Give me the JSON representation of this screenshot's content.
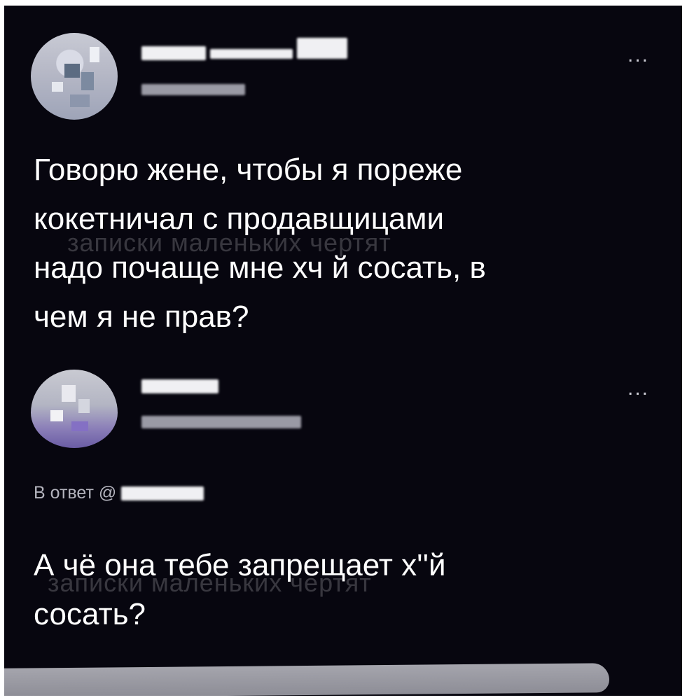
{
  "post": {
    "text": "Говорю жене, чтобы я пореже\nкокетничал с продавщицами\nнадо почаще мне хч й сосать, в\nчем я не прав?",
    "more_label": "..."
  },
  "reply": {
    "reply_prefix": "В ответ @",
    "text": "А чё она тебе запрещает х''й\nсосать?",
    "more_label": "..."
  },
  "watermark": {
    "text": "записки маленьких чертят"
  }
}
